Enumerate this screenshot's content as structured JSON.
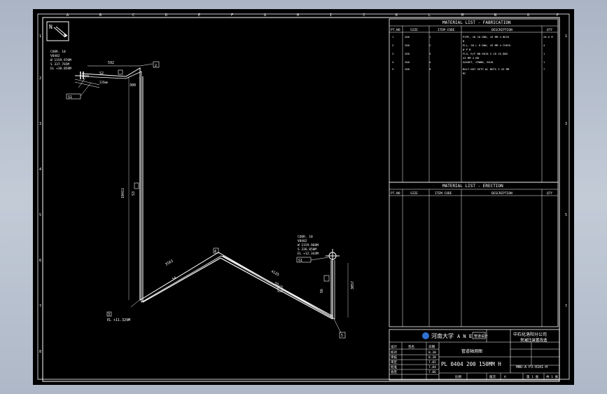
{
  "grid": {
    "top": [
      "A",
      "B",
      "C",
      "D",
      "E",
      "F",
      "G",
      "H",
      "I",
      "J",
      "K",
      "L",
      "M",
      "N",
      "O",
      "P"
    ],
    "side": [
      "1",
      "2",
      "3",
      "4",
      "5",
      "6",
      "7",
      "8"
    ]
  },
  "north": "N",
  "coord_top": {
    "label": "COOR. 10",
    "id": "V0402",
    "w": "W 1159.970M",
    "s": "S 337.765M",
    "el": "EL +20.058M"
  },
  "coord_right": {
    "label": "COOR. 10",
    "id": "V0402",
    "w": "W 1159.960M",
    "s": "S 336.850M",
    "el": "EL +12.344M"
  },
  "dims": {
    "top": "592",
    "cut": "300",
    "vertical": "10411",
    "diag_left": "3563",
    "diag_right": "4125",
    "right_vert": "3057",
    "el_bottom": "EL +11.329M",
    "small1": "235mm"
  },
  "spools": {
    "s1": "S1",
    "s2": "S2",
    "s3": "S3",
    "s4": "S4",
    "s5": "S5",
    "s6": "S6"
  },
  "tags": [
    "1",
    "2",
    "3",
    "4",
    "5",
    "6",
    "7"
  ],
  "fabrication": {
    "title": "MATERIAL LIST - FABRICATION",
    "headers": [
      "PT.NO",
      "SIZE",
      "ITEM CODE",
      "DESCRIPTION",
      "QTY"
    ],
    "rows": [
      [
        "1",
        "200",
        "1",
        "PIPE, 20 10 DWG, 43 MM 4 BECK",
        "20.6 M"
      ],
      [
        "",
        "",
        "",
        "B",
        ""
      ],
      [
        "2",
        "200",
        "2",
        "ELL, 90 L R DWG, 43 MM 4 CHECK",
        "4"
      ],
      [
        "",
        "",
        "",
        "W P B",
        ""
      ],
      [
        "3",
        "200",
        "3",
        "FLG, R/F WN 6018 S 20 10 DWG",
        "1"
      ],
      [
        "",
        "",
        "",
        "43 MM 4 BB",
        ""
      ],
      [
        "4",
        "200",
        "4",
        "GASKET, SPWND, 6018",
        "1"
      ],
      [
        "5",
        "200",
        "5",
        "BOLT NUT SETS W/ NUTS 3 43 MM",
        "7"
      ],
      [
        "",
        "",
        "",
        "BC",
        ""
      ]
    ]
  },
  "erection": {
    "title": "MATERIAL LIST - ERECTION",
    "headers": [
      "PT.NO",
      "SIZE",
      "ITEM CODE",
      "DESCRIPTION",
      "QTY"
    ]
  },
  "title_block": {
    "university": "河南大学",
    "abbr": "A N E",
    "small": "管道设计",
    "company": "中石化洛阳分公司",
    "project": "常减压装置改造",
    "drawing_name": "管道轴测图",
    "line_no": "PL 0404 200 150MM H",
    "sheet_no": "HNU-A P3-0101-H",
    "left_rows": [
      [
        "设计",
        "签名",
        "日期"
      ],
      [
        "校对",
        "",
        "0.38"
      ],
      [
        "审核",
        "",
        "0.38"
      ],
      [
        "审定",
        "",
        "7.05"
      ],
      [
        "批准",
        "",
        "7.04"
      ],
      [
        "会签",
        "",
        "7.06"
      ]
    ],
    "bottom": [
      "比例",
      "",
      "版次",
      "A",
      "第 1 张",
      "共 1 张"
    ]
  }
}
